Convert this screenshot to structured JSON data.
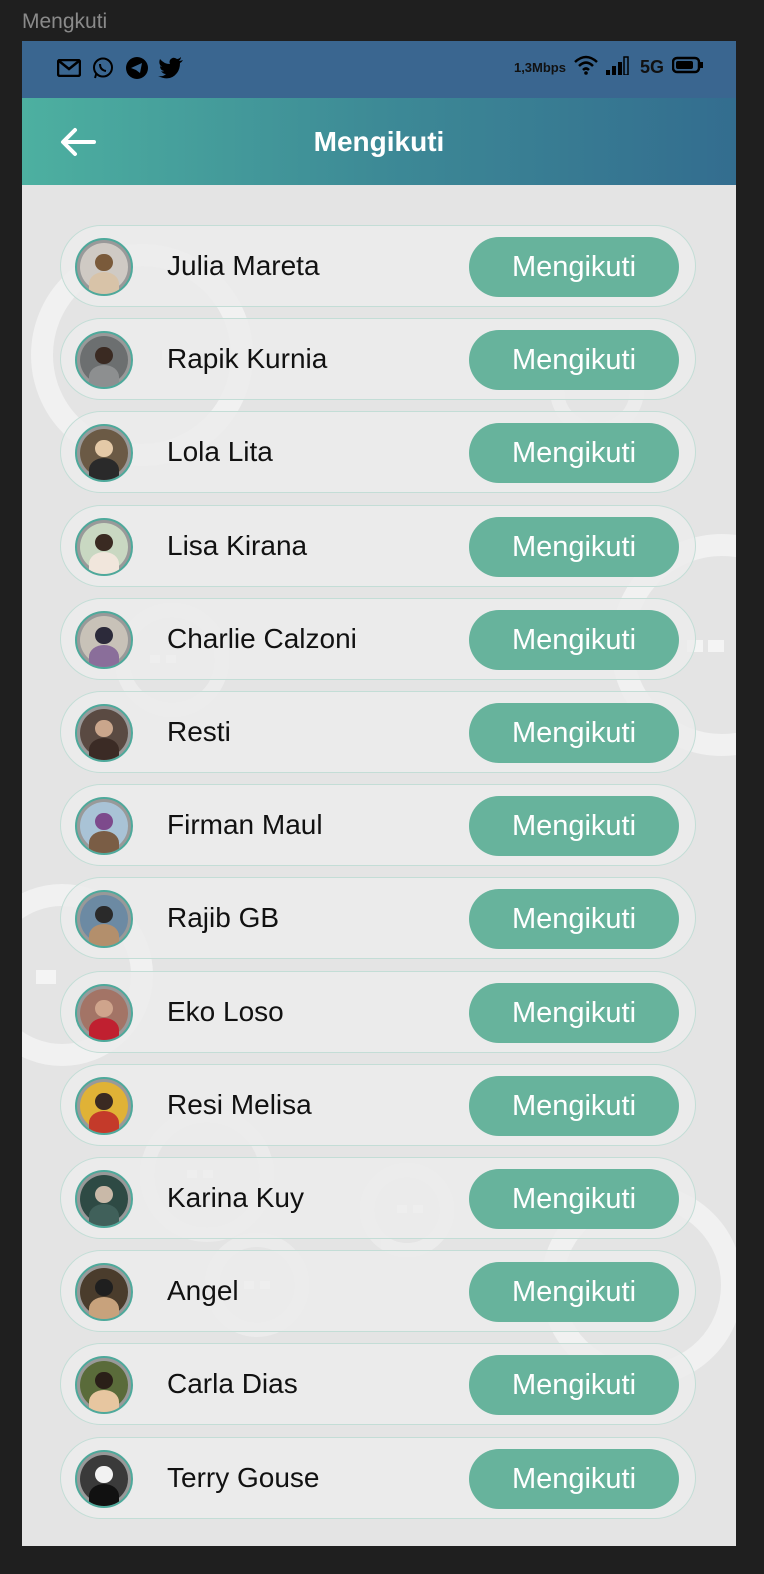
{
  "window_title": "Mengkuti",
  "status_bar": {
    "left_icons": [
      "gmail-icon",
      "whatsapp-icon",
      "telegram-icon",
      "twitter-icon"
    ],
    "speed": "1,3Mbps",
    "network": "5G"
  },
  "app_bar": {
    "title": "Mengikuti",
    "colors": {
      "start": "#4db0a0",
      "end": "#336d8f"
    }
  },
  "theme": {
    "button_color": "#67b39c",
    "avatar_ring": "#4ea99b",
    "background": "#e4e4e4"
  },
  "users": [
    {
      "name": "Julia Mareta",
      "button": "Mengikuti"
    },
    {
      "name": "Rapik Kurnia",
      "button": "Mengikuti"
    },
    {
      "name": "Lola Lita",
      "button": "Mengikuti"
    },
    {
      "name": "Lisa Kirana",
      "button": "Mengikuti"
    },
    {
      "name": "Charlie Calzoni",
      "button": "Mengikuti"
    },
    {
      "name": "Resti",
      "button": "Mengikuti"
    },
    {
      "name": "Firman Maul",
      "button": "Mengikuti"
    },
    {
      "name": "Rajib GB",
      "button": "Mengikuti"
    },
    {
      "name": "Eko Loso",
      "button": "Mengikuti"
    },
    {
      "name": "Resi Melisa",
      "button": "Mengikuti"
    },
    {
      "name": "Karina Kuy",
      "button": "Mengikuti"
    },
    {
      "name": "Angel",
      "button": "Mengikuti"
    },
    {
      "name": "Carla Dias",
      "button": "Mengikuti"
    },
    {
      "name": "Terry Gouse",
      "button": "Mengikuti"
    }
  ]
}
